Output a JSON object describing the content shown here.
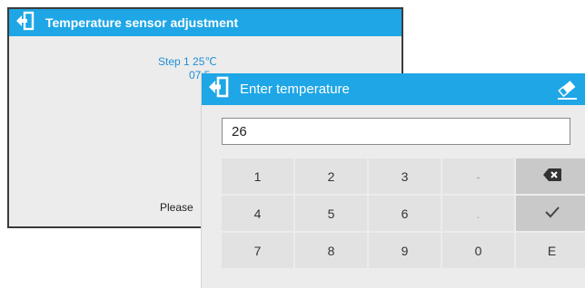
{
  "background_window": {
    "title": "Temperature sensor adjustment",
    "step_text": "Step 1  25℃",
    "time_text": "07:5",
    "message_text": "Please"
  },
  "dialog": {
    "title": "Enter temperature",
    "input_value": "26",
    "keys": [
      {
        "label": "1",
        "name": "key-1"
      },
      {
        "label": "2",
        "name": "key-2"
      },
      {
        "label": "3",
        "name": "key-3"
      },
      {
        "label": "-",
        "name": "key-minus",
        "light": true
      },
      {
        "label": "",
        "name": "backspace-key",
        "icon": "backspace-icon",
        "action": true
      },
      {
        "label": "4",
        "name": "key-4"
      },
      {
        "label": "5",
        "name": "key-5"
      },
      {
        "label": "6",
        "name": "key-6"
      },
      {
        "label": ".",
        "name": "key-dot",
        "light": true
      },
      {
        "label": "",
        "name": "confirm-key",
        "icon": "check-icon",
        "action": true
      },
      {
        "label": "7",
        "name": "key-7"
      },
      {
        "label": "8",
        "name": "key-8"
      },
      {
        "label": "9",
        "name": "key-9"
      },
      {
        "label": "0",
        "name": "key-0"
      },
      {
        "label": "E",
        "name": "key-e"
      }
    ]
  },
  "icons": {
    "exit": "exit-icon",
    "eraser": "eraser-icon",
    "backspace": "backspace-icon",
    "check": "check-icon"
  },
  "colors": {
    "accent": "#1ea6e6",
    "step_text": "#1e8fd6",
    "panel": "#ececec",
    "key": "#e2e2e2",
    "key_action": "#c9c9c9"
  }
}
